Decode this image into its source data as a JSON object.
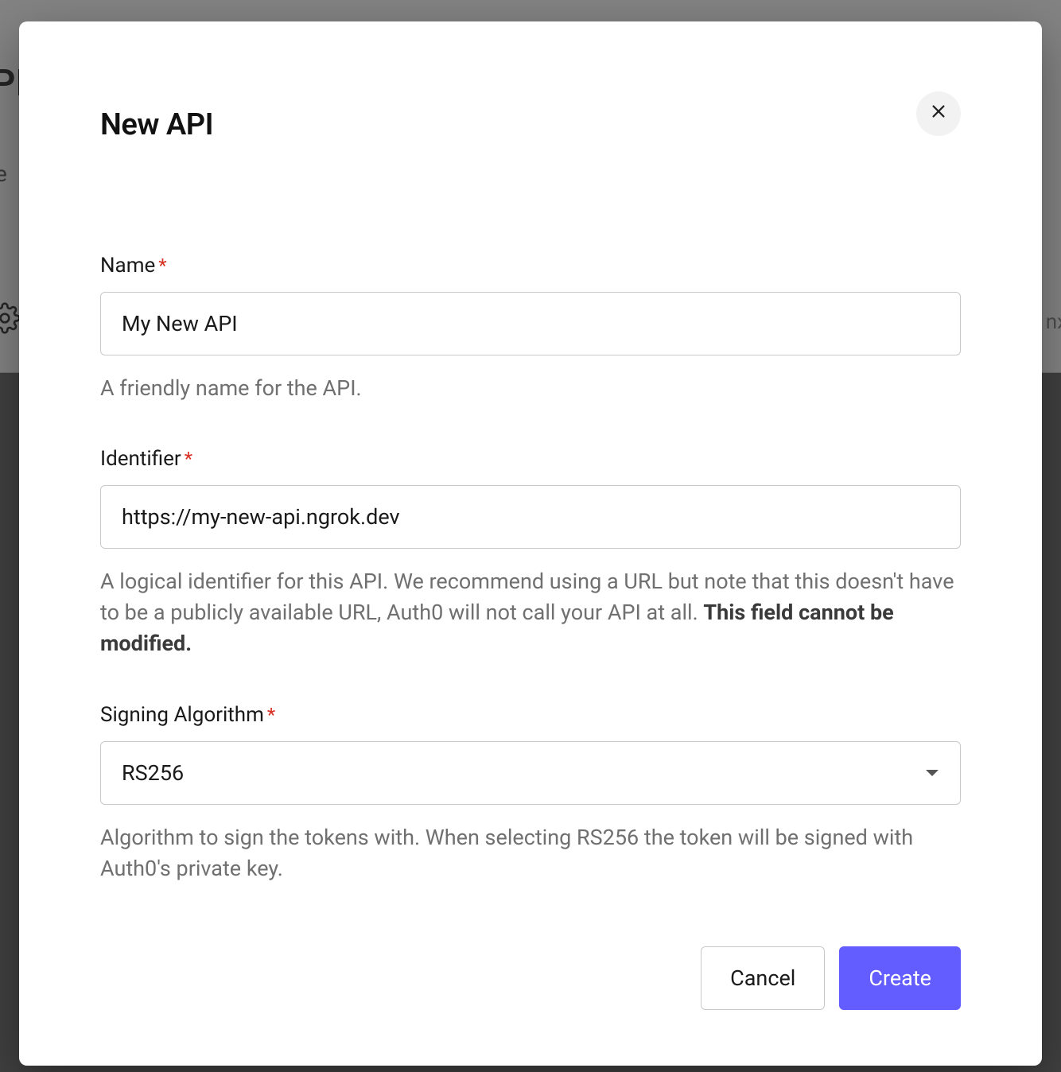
{
  "background": {
    "title_fragment": "PI",
    "subtitle_fragment": "e",
    "right_fragment": "nx"
  },
  "modal": {
    "title": "New API",
    "close_aria": "Close",
    "fields": {
      "name": {
        "label": "Name",
        "value": "My New API",
        "help": "A friendly name for the API."
      },
      "identifier": {
        "label": "Identifier",
        "value": "https://my-new-api.ngrok.dev",
        "help_pre": "A logical identifier for this API. We recommend using a URL but note that this doesn't have to be a publicly available URL, Auth0 will not call your API at all. ",
        "help_strong": "This field cannot be modified."
      },
      "algorithm": {
        "label": "Signing Algorithm",
        "value": "RS256",
        "help": "Algorithm to sign the tokens with. When selecting RS256 the token will be signed with Auth0's private key."
      }
    },
    "footer": {
      "cancel": "Cancel",
      "create": "Create"
    }
  }
}
